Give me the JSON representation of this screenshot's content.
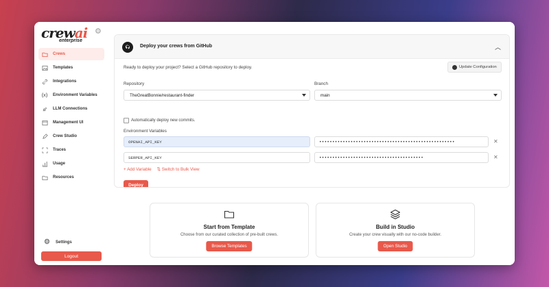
{
  "brand": {
    "logo_word": "crew",
    "logo_ai": "ai",
    "logo_sub": "enterprise"
  },
  "sidebar": {
    "items": [
      {
        "label": "Crews",
        "icon": "folder-icon",
        "active": true
      },
      {
        "label": "Templates",
        "icon": "image-icon"
      },
      {
        "label": "Integrations",
        "icon": "link-icon"
      },
      {
        "label": "Environment Variables",
        "icon": "variable-icon"
      },
      {
        "label": "LLM Connections",
        "icon": "plug-icon"
      },
      {
        "label": "Management UI",
        "icon": "browser-icon"
      },
      {
        "label": "Crew Studio",
        "icon": "pencil-icon"
      },
      {
        "label": "Traces",
        "icon": "scan-icon"
      },
      {
        "label": "Usage",
        "icon": "bar-chart-icon"
      },
      {
        "label": "Resources",
        "icon": "folder-icon"
      }
    ],
    "settings_label": "Settings",
    "logout_label": "Logout"
  },
  "deploy": {
    "title": "Deploy your crews from GitHub",
    "ready_text": "Ready to deploy your project? Select a GitHub repository to deploy.",
    "update_button": "Update Configuration",
    "repository_label": "Repository",
    "repository_value": "TheGreatBonnie/restaurant-finder",
    "branch_label": "Branch",
    "branch_value": "main",
    "auto_deploy_label": "Automatically deploy new commits.",
    "env_label": "Environment Variables",
    "env_vars": [
      {
        "key": "OPENAI_API_KEY",
        "value": "••••••••••••••••••••••••••••••••••••••••••••••••••••"
      },
      {
        "key": "SERPER_API_KEY",
        "value": "••••••••••••••••••••••••••••••••••••••••"
      }
    ],
    "add_variable": "+ Add Variable",
    "bulk_view": "⇅ Switch to Bulk View",
    "deploy_button": "Deploy"
  },
  "cards": [
    {
      "title": "Start from Template",
      "desc": "Choose from our curated collection of pre-built crews.",
      "button": "Browse Templates",
      "icon": "folder-icon"
    },
    {
      "title": "Build in Studio",
      "desc": "Create your crew visually with our no-code builder.",
      "button": "Open Studio",
      "icon": "layers-icon"
    }
  ],
  "colors": {
    "accent": "#e8594b",
    "highlight": "#e6eefb"
  }
}
